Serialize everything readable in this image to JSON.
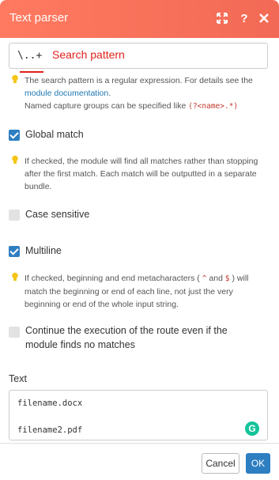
{
  "header": {
    "title": "Text parser",
    "icons": [
      "expand-icon",
      "help-icon",
      "close-icon"
    ],
    "color": "#f26a55"
  },
  "pattern": {
    "value": "\\..+",
    "annotation": "Search pattern",
    "annotation_color": "#e0201b",
    "hint_text_1": "The search pattern is a regular expression. For details see the",
    "hint_link": "module documentation",
    "hint_after_link": ".",
    "hint_text_2": "Named capture groups can be specified like",
    "hint_code": "(?<name>.*)"
  },
  "global_match": {
    "label": "Global match",
    "checked": true,
    "hint_1": "If checked, the module will find all matches rather than stopping",
    "hint_2": "after the first match. Each match will be outputted in a separate",
    "hint_3": "bundle."
  },
  "case_sensitive": {
    "label": "Case sensitive",
    "checked": false
  },
  "multiline": {
    "label": "Multiline",
    "checked": true,
    "hint_1a": "If checked, beginning and end metacharacters (",
    "caret": "^",
    "and": "and",
    "dollar": "$",
    "hint_1b": ") will",
    "hint_2": "match the beginning or end of each line, not just the very",
    "hint_3": "beginning or end of the whole input string."
  },
  "continue_execution": {
    "label_1": "Continue the execution of the route even if the",
    "label_2": "module finds no matches",
    "checked": false
  },
  "text_field": {
    "label": "Text",
    "lines": [
      "filename.docx",
      "filename2.pdf"
    ]
  },
  "footer": {
    "cancel_label": "Cancel",
    "ok_label": "OK",
    "accent": "#2e7ec2"
  }
}
